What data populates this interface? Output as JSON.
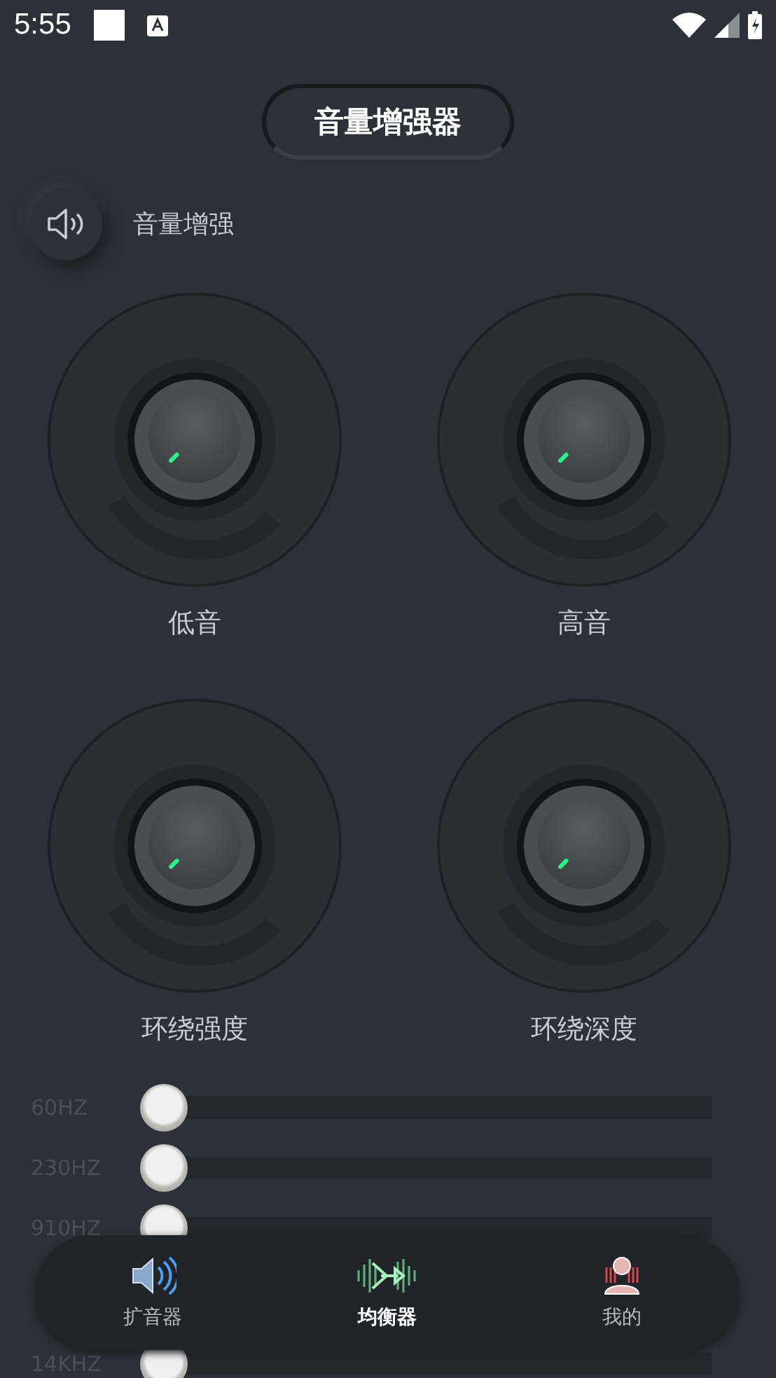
{
  "status_bar": {
    "time": "5:55"
  },
  "title": "音量增强器",
  "boost": {
    "label": "音量增强",
    "on": false
  },
  "knobs": [
    {
      "label": "低音"
    },
    {
      "label": "高音"
    },
    {
      "label": "环绕强度"
    },
    {
      "label": "环绕深度"
    }
  ],
  "equalizer": [
    {
      "label": "60HZ",
      "level": 0
    },
    {
      "label": "230HZ",
      "level": 0
    },
    {
      "label": "910HZ",
      "level": 0
    },
    {
      "label": "14KHZ",
      "level": 0
    }
  ],
  "nav": [
    {
      "label": "扩音器",
      "kind": "speaker",
      "selected": false
    },
    {
      "label": "均衡器",
      "kind": "equalizer",
      "selected": true
    },
    {
      "label": "我的",
      "kind": "profile",
      "selected": false
    }
  ]
}
